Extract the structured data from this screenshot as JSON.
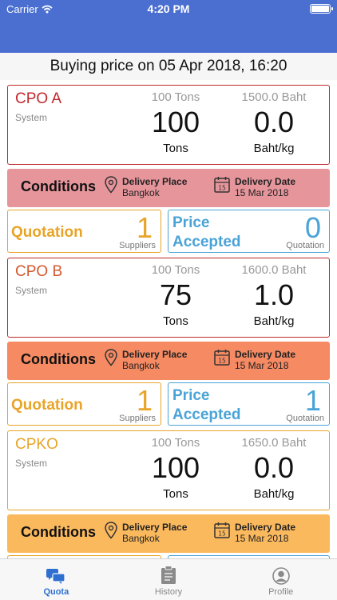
{
  "status_bar": {
    "carrier": "Carrier",
    "time": "4:20 PM"
  },
  "subheader": {
    "title": "Buying price on 05 Apr 2018, 16:20"
  },
  "products": [
    {
      "name": "CPO A",
      "source": "System",
      "tons_total": "100 Tons",
      "tons_value": "100",
      "tons_unit": "Tons",
      "price_total": "1500.0 Baht",
      "price_value": "0.0",
      "price_unit": "Baht/kg",
      "name_color": "#c0282d",
      "border_color": "#c0282d",
      "cond_color": "#e6959b",
      "conditions": {
        "title": "Conditions",
        "place_label": "Delivery Place",
        "place_value": "Bangkok",
        "date_label": "Delivery Date",
        "date_value": "15 Mar 2018"
      },
      "quotation": {
        "label": "Quotation",
        "count": "1",
        "unit": "Suppliers"
      },
      "accepted": {
        "label_line1": "Price",
        "label_line2": "Accepted",
        "count": "0",
        "unit": "Quotation"
      }
    },
    {
      "name": "CPO B",
      "source": "System",
      "tons_total": "100 Tons",
      "tons_value": "75",
      "tons_unit": "Tons",
      "price_total": "1600.0 Baht",
      "price_value": "1.0",
      "price_unit": "Baht/kg",
      "name_color": "#d3582f",
      "border_color": "#c0282d",
      "cond_color": "#f58a63",
      "conditions": {
        "title": "Conditions",
        "place_label": "Delivery Place",
        "place_value": "Bangkok",
        "date_label": "Delivery Date",
        "date_value": "15 Mar 2018"
      },
      "quotation": {
        "label": "Quotation",
        "count": "1",
        "unit": "Suppliers"
      },
      "accepted": {
        "label_line1": "Price",
        "label_line2": "Accepted",
        "count": "1",
        "unit": "Quotation"
      }
    },
    {
      "name": "CPKO",
      "source": "System",
      "tons_total": "100 Tons",
      "tons_value": "100",
      "tons_unit": "Tons",
      "price_total": "1650.0 Baht",
      "price_value": "0.0",
      "price_unit": "Baht/kg",
      "name_color": "#e8a428",
      "border_color": "#e8a428",
      "cond_color": "#fbb95e",
      "conditions": {
        "title": "Conditions",
        "place_label": "Delivery Place",
        "place_value": "Bangkok",
        "date_label": "Delivery Date",
        "date_value": "15 Mar 2018"
      },
      "quotation": {
        "label": "",
        "count": "",
        "unit": ""
      },
      "accepted": {
        "label_line1": "",
        "label_line2": "",
        "count": "",
        "unit": ""
      }
    }
  ],
  "tabbar": {
    "tabs": [
      {
        "label": "Quota",
        "icon": "chat-bubbles-icon",
        "active": true
      },
      {
        "label": "History",
        "icon": "clipboard-icon",
        "active": false
      },
      {
        "label": "Profile",
        "icon": "person-circle-icon",
        "active": false
      }
    ]
  },
  "colors": {
    "header": "#4a6fd1",
    "quotation": "#e8a428",
    "accepted": "#4aa3d6",
    "active_tab": "#2f6fcf"
  }
}
